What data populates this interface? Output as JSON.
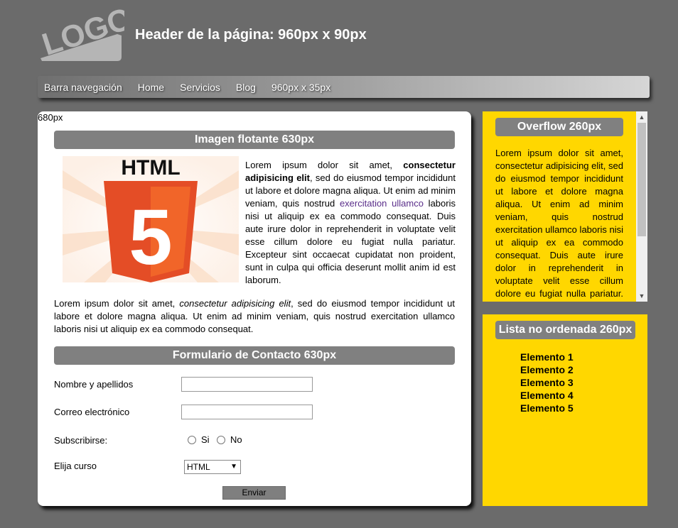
{
  "header": {
    "logo_text": "LOGO",
    "title": "Header de la página: 960px x 90px"
  },
  "nav": {
    "items": [
      "Barra navegación",
      "Home",
      "Servicios",
      "Blog",
      "960px x 35px"
    ]
  },
  "main": {
    "width_label": "680px",
    "image_section_title": "Imagen flotante 630px",
    "image_text": "HTML",
    "image_number": "5",
    "float_text_start": "Lorem ipsum dolor sit amet, ",
    "float_text_bold": "consectetur adipisicing elit",
    "float_text_mid": ", sed do eiusmod tempor incididunt ut labore et dolore magna aliqua. Ut enim ad minim veniam, quis nostrud ",
    "float_text_link": "exercitation ullamco",
    "float_text_end": " laboris nisi ut aliquip ex ea commodo consequat. Duis aute irure dolor in reprehenderit in voluptate velit esse cillum dolore eu fugiat nulla pariatur. Excepteur sint occaecat cupidatat non proident, sunt in culpa qui officia deserunt mollit anim id est laborum.",
    "para2_start": "Lorem ipsum dolor sit amet, ",
    "para2_italic": "consectetur adipisicing elit",
    "para2_end": ", sed do eiusmod tempor incididunt ut labore et dolore magna aliqua. Ut enim ad minim veniam, quis nostrud exercitation ullamco laboris nisi ut aliquip ex ea commodo consequat.",
    "form_section_title": "Formulario de Contacto 630px",
    "form": {
      "name_label": "Nombre y apellidos",
      "name_value": "",
      "email_label": "Correo electrónico",
      "email_value": "",
      "subscribe_label": "Subscribirse:",
      "radio_yes": "Si",
      "radio_no": "No",
      "course_label": "Elija curso",
      "course_selected": "HTML",
      "submit_label": "Enviar"
    }
  },
  "sidebar": {
    "overflow_title": "Overflow 260px",
    "overflow_text": "Lorem ipsum dolor sit amet, consectetur adipisicing elit, sed do eiusmod tempor incididunt ut labore et dolore magna aliqua. Ut enim ad minim veniam, quis nostrud exercitation ullamco laboris nisi ut aliquip ex ea commodo consequat. Duis aute irure dolor in reprehenderit in voluptate velit esse cillum dolore eu fugiat nulla pariatur. Excepteur sint occaecat cupidatat non proident, sunt in culpa qui officia deserunt mollit anim id est laborum.",
    "list_title": "Lista no ordenada 260px",
    "list_items": [
      "Elemento 1",
      "Elemento 2",
      "Elemento 3",
      "Elemento 4",
      "Elemento 5"
    ]
  },
  "colors": {
    "background": "#6b6b6b",
    "sidebar_yellow": "#ffd700",
    "section_gray": "#808080",
    "html5_orange": "#e44d26",
    "link_purple": "#5a2e8a"
  }
}
